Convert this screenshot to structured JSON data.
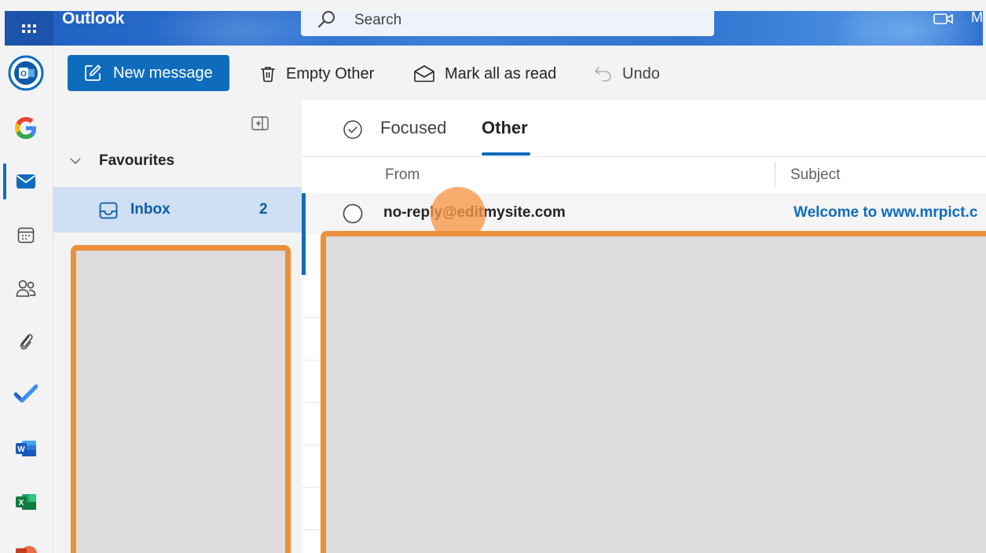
{
  "header": {
    "app_title": "Outlook",
    "search_placeholder": "Search",
    "truncated_text": "M"
  },
  "rail": {
    "items": [
      "outlook-icon",
      "google-icon",
      "mail-icon",
      "calendar-icon",
      "people-icon",
      "attachment-icon",
      "todo-icon",
      "word-icon",
      "excel-icon",
      "powerpoint-icon"
    ],
    "active": "mail-icon"
  },
  "toolbar": {
    "new_message": "New message",
    "empty_other": "Empty Other",
    "mark_all_read": "Mark all as read",
    "undo": "Undo"
  },
  "folders": {
    "favourites_label": "Favourites",
    "inbox_label": "Inbox",
    "inbox_count": "2"
  },
  "message_list": {
    "tab_focused": "Focused",
    "tab_other": "Other",
    "active_tab": "Other",
    "col_from": "From",
    "col_subject": "Subject",
    "rows": [
      {
        "from": "no-reply@editmysite.com",
        "subject": "Welcome to www.mrpict.c"
      }
    ]
  },
  "colors": {
    "accent": "#0f6cbd",
    "highlight_border": "#ec8f3c",
    "click_marker": "#f79646",
    "redaction_fill": "#dcdcdc"
  }
}
